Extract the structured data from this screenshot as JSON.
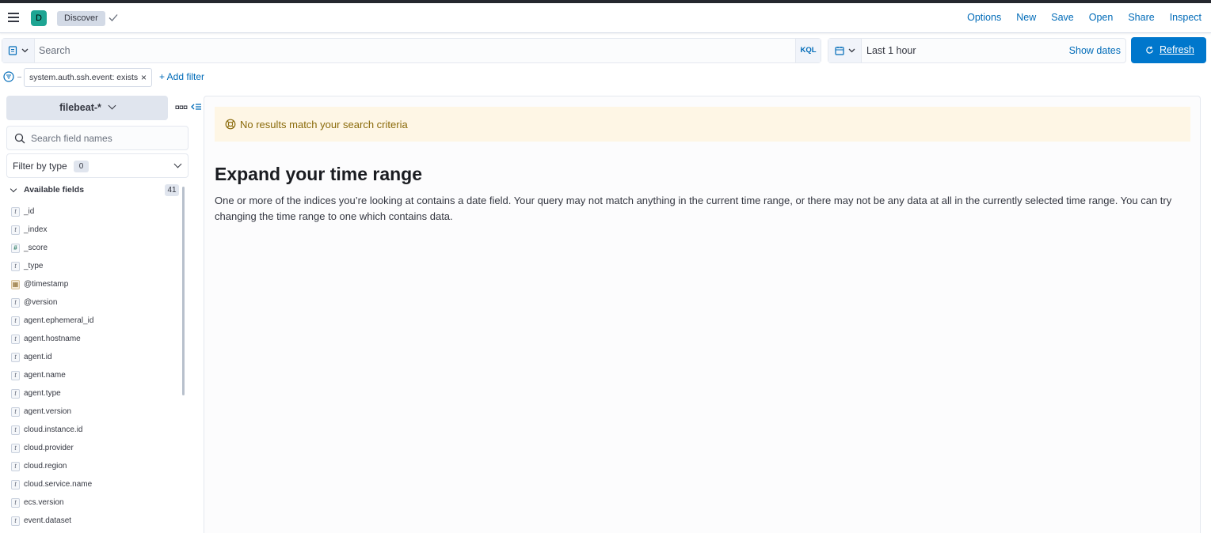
{
  "header": {
    "avatar_letter": "D",
    "breadcrumb": "Discover",
    "menu": [
      "Options",
      "New",
      "Save",
      "Open",
      "Share",
      "Inspect"
    ]
  },
  "query": {
    "placeholder": "Search",
    "language": "KQL"
  },
  "time": {
    "range": "Last 1 hour",
    "show_dates": "Show dates",
    "refresh": "Refresh"
  },
  "filters": {
    "pill": "system.auth.ssh.event: exists",
    "add": "+ Add filter"
  },
  "sidebar": {
    "index_pattern": "filebeat-*",
    "search_placeholder": "Search field names",
    "filter_by_type": "Filter by type",
    "filter_count": "0",
    "available_label": "Available fields",
    "available_count": "41",
    "fields": [
      {
        "name": "_id",
        "type": "t"
      },
      {
        "name": "_index",
        "type": "t"
      },
      {
        "name": "_score",
        "type": "#"
      },
      {
        "name": "_type",
        "type": "t"
      },
      {
        "name": "@timestamp",
        "type": "date"
      },
      {
        "name": "@version",
        "type": "t"
      },
      {
        "name": "agent.ephemeral_id",
        "type": "t"
      },
      {
        "name": "agent.hostname",
        "type": "t"
      },
      {
        "name": "agent.id",
        "type": "t"
      },
      {
        "name": "agent.name",
        "type": "t"
      },
      {
        "name": "agent.type",
        "type": "t"
      },
      {
        "name": "agent.version",
        "type": "t"
      },
      {
        "name": "cloud.instance.id",
        "type": "t"
      },
      {
        "name": "cloud.provider",
        "type": "t"
      },
      {
        "name": "cloud.region",
        "type": "t"
      },
      {
        "name": "cloud.service.name",
        "type": "t"
      },
      {
        "name": "ecs.version",
        "type": "t"
      },
      {
        "name": "event.dataset",
        "type": "t"
      }
    ]
  },
  "main": {
    "callout": "No results match your search criteria",
    "title": "Expand your time range",
    "body": "One or more of the indices you’re looking at contains a date field. Your query may not match anything in the current time range, or there may not be any data at all in the currently selected time range. You can try changing the time range to one which contains data."
  },
  "colors": {
    "accent": "#0077cc",
    "link": "#006bb8",
    "warning_bg": "#fef6e5",
    "warning_text": "#8a6a0a"
  }
}
